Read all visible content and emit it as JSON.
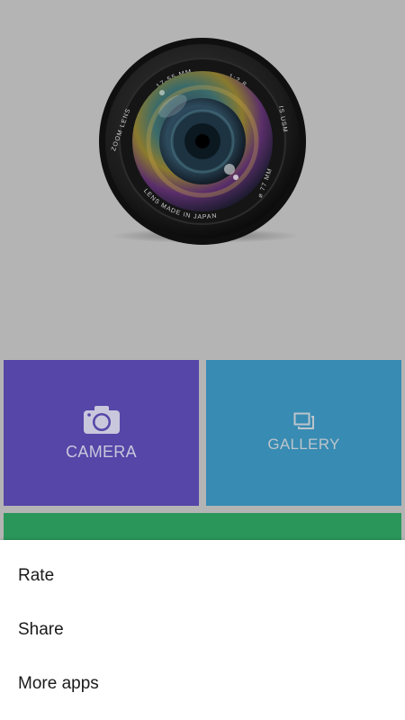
{
  "lens": {
    "engraving_top": "17-55 MM",
    "engraving_aperture": "1:2.8",
    "engraving_left": "ZOOM LENS",
    "engraving_right": "IS USM",
    "engraving_diameter": "⌀ 77 MM",
    "engraving_bottom": "LENS MADE IN JAPAN"
  },
  "tiles": [
    {
      "label": "CAMERA",
      "color": "#5546a8",
      "icon": "camera-icon"
    },
    {
      "label": "GALLERY",
      "color": "#388bb2",
      "icon": "gallery-icon"
    },
    {
      "label": "",
      "color": "#2b965a"
    }
  ],
  "menu": {
    "items": [
      {
        "label": "Rate"
      },
      {
        "label": "Share"
      },
      {
        "label": "More apps"
      }
    ]
  }
}
